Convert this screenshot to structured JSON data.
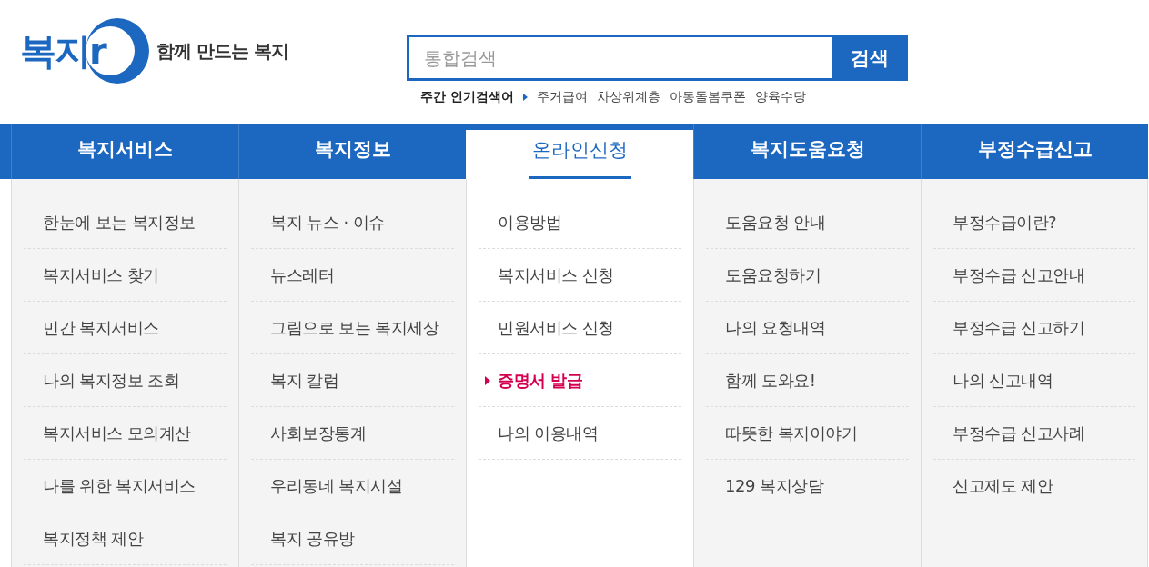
{
  "header": {
    "logo": {
      "text": "복지r"
    },
    "tagline": "함께 만드는 복지",
    "search": {
      "placeholder": "통합검색",
      "button": "검색"
    },
    "popular": {
      "label": "주간 인기검색어",
      "keywords": [
        "주거급여",
        "차상위계층",
        "아동돌봄쿠폰",
        "양육수당"
      ]
    }
  },
  "nav": {
    "menus": [
      {
        "label": "복지서비스",
        "selected": false,
        "items": [
          {
            "label": "한눈에 보는 복지정보",
            "selected": false
          },
          {
            "label": "복지서비스 찾기",
            "selected": false
          },
          {
            "label": "민간 복지서비스",
            "selected": false
          },
          {
            "label": "나의 복지정보 조회",
            "selected": false
          },
          {
            "label": "복지서비스 모의계산",
            "selected": false
          },
          {
            "label": "나를 위한 복지서비스",
            "selected": false
          },
          {
            "label": "복지정책 제안",
            "selected": false
          }
        ]
      },
      {
        "label": "복지정보",
        "selected": false,
        "items": [
          {
            "label": "복지 뉴스 · 이슈",
            "selected": false
          },
          {
            "label": "뉴스레터",
            "selected": false
          },
          {
            "label": "그림으로 보는 복지세상",
            "selected": false
          },
          {
            "label": "복지 칼럼",
            "selected": false
          },
          {
            "label": "사회보장통계",
            "selected": false
          },
          {
            "label": "우리동네 복지시설",
            "selected": false
          },
          {
            "label": "복지 공유방",
            "selected": false
          }
        ]
      },
      {
        "label": "온라인신청",
        "selected": true,
        "items": [
          {
            "label": "이용방법",
            "selected": false
          },
          {
            "label": "복지서비스 신청",
            "selected": false
          },
          {
            "label": "민원서비스 신청",
            "selected": false
          },
          {
            "label": "증명서 발급",
            "selected": true
          },
          {
            "label": "나의 이용내역",
            "selected": false
          }
        ]
      },
      {
        "label": "복지도움요청",
        "selected": false,
        "items": [
          {
            "label": "도움요청 안내",
            "selected": false
          },
          {
            "label": "도움요청하기",
            "selected": false
          },
          {
            "label": "나의 요청내역",
            "selected": false
          },
          {
            "label": "함께 도와요!",
            "selected": false
          },
          {
            "label": "따뜻한 복지이야기",
            "selected": false
          },
          {
            "label": "129 복지상담",
            "selected": false
          }
        ]
      },
      {
        "label": "부정수급신고",
        "selected": false,
        "items": [
          {
            "label": "부정수급이란?",
            "selected": false
          },
          {
            "label": "부정수급 신고안내",
            "selected": false
          },
          {
            "label": "부정수급 신고하기",
            "selected": false
          },
          {
            "label": "나의 신고내역",
            "selected": false
          },
          {
            "label": "부정수급 신고사례",
            "selected": false
          },
          {
            "label": "신고제도 제안",
            "selected": false
          }
        ]
      }
    ]
  }
}
